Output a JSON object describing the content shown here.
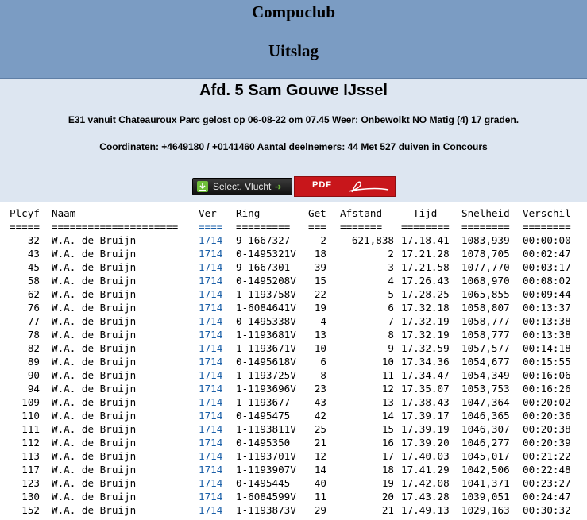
{
  "header": {
    "club": "Compuclub",
    "title": "Uitslag"
  },
  "info": {
    "section": "Afd. 5 Sam Gouwe IJssel",
    "race": "E31 vanuit Chateauroux Parc gelost op 06-08-22 om 07.45 Weer: Onbewolkt NO Matig (4) 17 graden.",
    "coords": "Coordinaten: +4649180 / +0141460 Aantal deelnemers: 44 Met 527 duiven in Concours"
  },
  "buttons": {
    "select": "Select. Vlucht",
    "pdf": "PDF"
  },
  "table": {
    "headers": [
      "Plcyf",
      "Naam",
      "Ver",
      "Ring",
      "Get",
      "Afstand",
      "Tijd",
      "Snelheid",
      "Verschil"
    ],
    "separators": [
      "=====",
      "=====================",
      "====",
      "=========",
      "===",
      "=======",
      "========",
      "========",
      "========"
    ],
    "rows": [
      [
        "32",
        "W.A. de Bruijn",
        "1714",
        "9-1667327",
        "2",
        "621,838",
        "17.18.41",
        "1083,939",
        "00:00:00"
      ],
      [
        "43",
        "W.A. de Bruijn",
        "1714",
        "0-1495321V",
        "18",
        "2",
        "17.21.28",
        "1078,705",
        "00:02:47"
      ],
      [
        "45",
        "W.A. de Bruijn",
        "1714",
        "9-1667301",
        "39",
        "3",
        "17.21.58",
        "1077,770",
        "00:03:17"
      ],
      [
        "58",
        "W.A. de Bruijn",
        "1714",
        "0-1495208V",
        "15",
        "4",
        "17.26.43",
        "1068,970",
        "00:08:02"
      ],
      [
        "62",
        "W.A. de Bruijn",
        "1714",
        "1-1193758V",
        "22",
        "5",
        "17.28.25",
        "1065,855",
        "00:09:44"
      ],
      [
        "76",
        "W.A. de Bruijn",
        "1714",
        "1-6084641V",
        "19",
        "6",
        "17.32.18",
        "1058,807",
        "00:13:37"
      ],
      [
        "77",
        "W.A. de Bruijn",
        "1714",
        "0-1495338V",
        "4",
        "7",
        "17.32.19",
        "1058,777",
        "00:13:38"
      ],
      [
        "78",
        "W.A. de Bruijn",
        "1714",
        "1-1193681V",
        "13",
        "8",
        "17.32.19",
        "1058,777",
        "00:13:38"
      ],
      [
        "82",
        "W.A. de Bruijn",
        "1714",
        "1-1193671V",
        "10",
        "9",
        "17.32.59",
        "1057,577",
        "00:14:18"
      ],
      [
        "89",
        "W.A. de Bruijn",
        "1714",
        "0-1495618V",
        "6",
        "10",
        "17.34.36",
        "1054,677",
        "00:15:55"
      ],
      [
        "90",
        "W.A. de Bruijn",
        "1714",
        "1-1193725V",
        "8",
        "11",
        "17.34.47",
        "1054,349",
        "00:16:06"
      ],
      [
        "94",
        "W.A. de Bruijn",
        "1714",
        "1-1193696V",
        "23",
        "12",
        "17.35.07",
        "1053,753",
        "00:16:26"
      ],
      [
        "109",
        "W.A. de Bruijn",
        "1714",
        "1-1193677",
        "43",
        "13",
        "17.38.43",
        "1047,364",
        "00:20:02"
      ],
      [
        "110",
        "W.A. de Bruijn",
        "1714",
        "0-1495475",
        "42",
        "14",
        "17.39.17",
        "1046,365",
        "00:20:36"
      ],
      [
        "111",
        "W.A. de Bruijn",
        "1714",
        "1-1193811V",
        "25",
        "15",
        "17.39.19",
        "1046,307",
        "00:20:38"
      ],
      [
        "112",
        "W.A. de Bruijn",
        "1714",
        "0-1495350",
        "21",
        "16",
        "17.39.20",
        "1046,277",
        "00:20:39"
      ],
      [
        "113",
        "W.A. de Bruijn",
        "1714",
        "1-1193701V",
        "12",
        "17",
        "17.40.03",
        "1045,017",
        "00:21:22"
      ],
      [
        "117",
        "W.A. de Bruijn",
        "1714",
        "1-1193907V",
        "14",
        "18",
        "17.41.29",
        "1042,506",
        "00:22:48"
      ],
      [
        "123",
        "W.A. de Bruijn",
        "1714",
        "0-1495445",
        "40",
        "19",
        "17.42.08",
        "1041,371",
        "00:23:27"
      ],
      [
        "130",
        "W.A. de Bruijn",
        "1714",
        "1-6084599V",
        "11",
        "20",
        "17.43.28",
        "1039,051",
        "00:24:47"
      ],
      [
        "152",
        "W.A. de Bruijn",
        "1714",
        "1-1193873V",
        "29",
        "21",
        "17.49.13",
        "1029,163",
        "00:30:32"
      ]
    ]
  }
}
